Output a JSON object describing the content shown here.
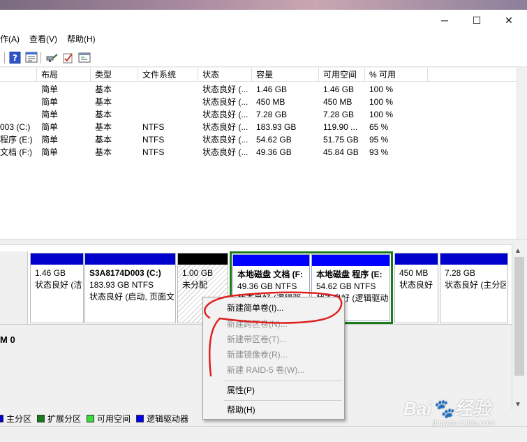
{
  "window": {
    "minimize_glyph": "─",
    "maximize_glyph": "☐",
    "close_glyph": "✕"
  },
  "menu": [
    "作(A)",
    "查看(V)",
    "帮助(H)"
  ],
  "toolbar": {
    "icons": [
      "help-icon",
      "properties-icon",
      "connect-icon",
      "check-icon",
      "console-icon"
    ]
  },
  "columns": [
    "布局",
    "类型",
    "文件系统",
    "状态",
    "容量",
    "可用空间",
    "% 可用"
  ],
  "rows": [
    {
      "name": "",
      "layout": "简单",
      "type": "基本",
      "fs": "",
      "status": "状态良好 (...",
      "capacity": "1.46 GB",
      "free": "1.46 GB",
      "pct": "100 %"
    },
    {
      "name": "",
      "layout": "简单",
      "type": "基本",
      "fs": "",
      "status": "状态良好 (...",
      "capacity": "450 MB",
      "free": "450 MB",
      "pct": "100 %"
    },
    {
      "name": "",
      "layout": "简单",
      "type": "基本",
      "fs": "",
      "status": "状态良好 (...",
      "capacity": "7.28 GB",
      "free": "7.28 GB",
      "pct": "100 %"
    },
    {
      "name": "003 (C:)",
      "layout": "简单",
      "type": "基本",
      "fs": "NTFS",
      "status": "状态良好 (...",
      "capacity": "183.93 GB",
      "free": "119.90 ...",
      "pct": "65 %"
    },
    {
      "name": "程序 (E:)",
      "layout": "简单",
      "type": "基本",
      "fs": "NTFS",
      "status": "状态良好 (...",
      "capacity": "54.62 GB",
      "free": "51.75 GB",
      "pct": "95 %"
    },
    {
      "name": "文档 (F:)",
      "layout": "简单",
      "type": "基本",
      "fs": "NTFS",
      "status": "状态良好 (...",
      "capacity": "49.36 GB",
      "free": "45.84 GB",
      "pct": "93 %"
    }
  ],
  "partitions": [
    {
      "title": "",
      "size": "1.46 GB",
      "status": "状态良好 (洁",
      "bar": "#0000cc"
    },
    {
      "title": "S3A8174D003  (C:)",
      "size": "183.93 GB NTFS",
      "status": "状态良好 (启动, 页面文",
      "bar": "#0000cc"
    },
    {
      "title": "",
      "size": "1.00 GB",
      "status": "未分配",
      "bar": "#000000"
    },
    {
      "title": "本地磁盘 文档  (F:",
      "size": "49.36 GB NTFS",
      "status": "状态良好 (逻辑驱",
      "bar": "#0000ff"
    },
    {
      "title": "本地磁盘 程序  (E:",
      "size": "54.62 GB NTFS",
      "status": "状态良好 (逻辑驱动",
      "bar": "#0000ff"
    },
    {
      "title": "",
      "size": "450 MB",
      "status": "状态良好",
      "bar": "#0000cc"
    },
    {
      "title": "",
      "size": "7.28 GB",
      "status": "状态良好 (主分区",
      "bar": "#0000cc"
    }
  ],
  "disk0_label": "M 0",
  "legend": [
    {
      "label": "主分区",
      "color": "#0000cc"
    },
    {
      "label": "扩展分区",
      "color": "#1b7a1b"
    },
    {
      "label": "可用空间",
      "color": "#3bdc3b"
    },
    {
      "label": "逻辑驱动器",
      "color": "#0000ff"
    }
  ],
  "context_menu": [
    {
      "label": "新建简单卷(I)...",
      "enabled": true
    },
    {
      "label": "新建跨区卷(N)...",
      "enabled": false
    },
    {
      "label": "新建带区卷(T)...",
      "enabled": false
    },
    {
      "label": "新建镜像卷(R)...",
      "enabled": false
    },
    {
      "label": "新建 RAID-5 卷(W)...",
      "enabled": false
    },
    {
      "label": "属性(P)",
      "enabled": true
    },
    {
      "label": "帮助(H)",
      "enabled": true
    }
  ],
  "watermark": {
    "main": "Bai🐾经验",
    "sub": "jingyan.baidu.com"
  }
}
